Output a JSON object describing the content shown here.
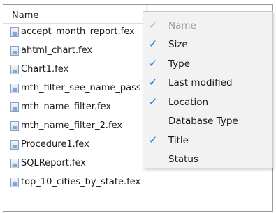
{
  "header": {
    "name_column": "Name"
  },
  "files": [
    "accept_month_report.fex",
    "ahtml_chart.fex",
    "Chart1.fex",
    "mth_filter_see_name_pass",
    "mth_name_filter.fex",
    "mth_name_filter_2.fex",
    "Procedure1.fex",
    "SQLReport.fex",
    "top_10_cities_by_state.fex"
  ],
  "menu": {
    "items": [
      {
        "label": "Name",
        "checked": true,
        "disabled": true
      },
      {
        "label": "Size",
        "checked": true
      },
      {
        "label": "Type",
        "checked": true
      },
      {
        "label": "Last modified",
        "checked": true
      },
      {
        "label": "Location",
        "checked": true
      },
      {
        "label": "Database Type",
        "checked": false
      },
      {
        "label": "Title",
        "checked": true
      },
      {
        "label": "Status",
        "checked": false
      }
    ],
    "check_glyph": "✓",
    "colors": {
      "check": "#1f7fe0",
      "menu_bg": "#f2f2f2"
    }
  }
}
